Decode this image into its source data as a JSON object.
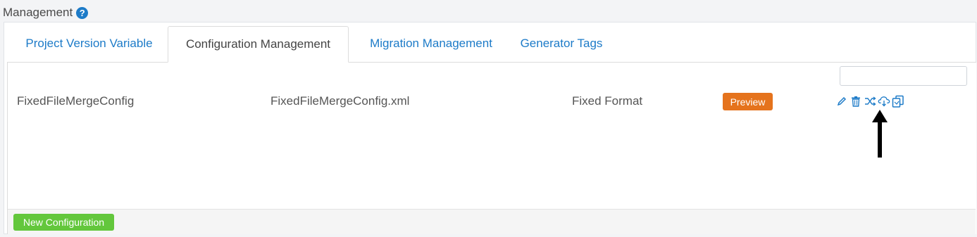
{
  "header": {
    "title": "Management",
    "help_icon": "question-circle-icon"
  },
  "tabs": [
    {
      "label": "Project Version Variable",
      "active": false
    },
    {
      "label": "Configuration Management",
      "active": true
    },
    {
      "label": "Migration Management",
      "active": false
    },
    {
      "label": "Generator Tags",
      "active": false
    }
  ],
  "search": {
    "value": "",
    "placeholder": ""
  },
  "table": {
    "rows": [
      {
        "name": "FixedFileMergeConfig",
        "file": "FixedFileMergeConfig.xml",
        "format": "Fixed Format",
        "preview_label": "Preview",
        "actions": [
          "pencil-icon",
          "trash-icon",
          "shuffle-icon",
          "cloud-download-icon",
          "copy-icon"
        ]
      }
    ]
  },
  "annotation": {
    "icon": "arrow-up-icon"
  },
  "footer": {
    "new_button_label": "New Configuration"
  },
  "colors": {
    "link": "#1d7bc8",
    "preview": "#e5731d",
    "new_button": "#63c73c"
  }
}
